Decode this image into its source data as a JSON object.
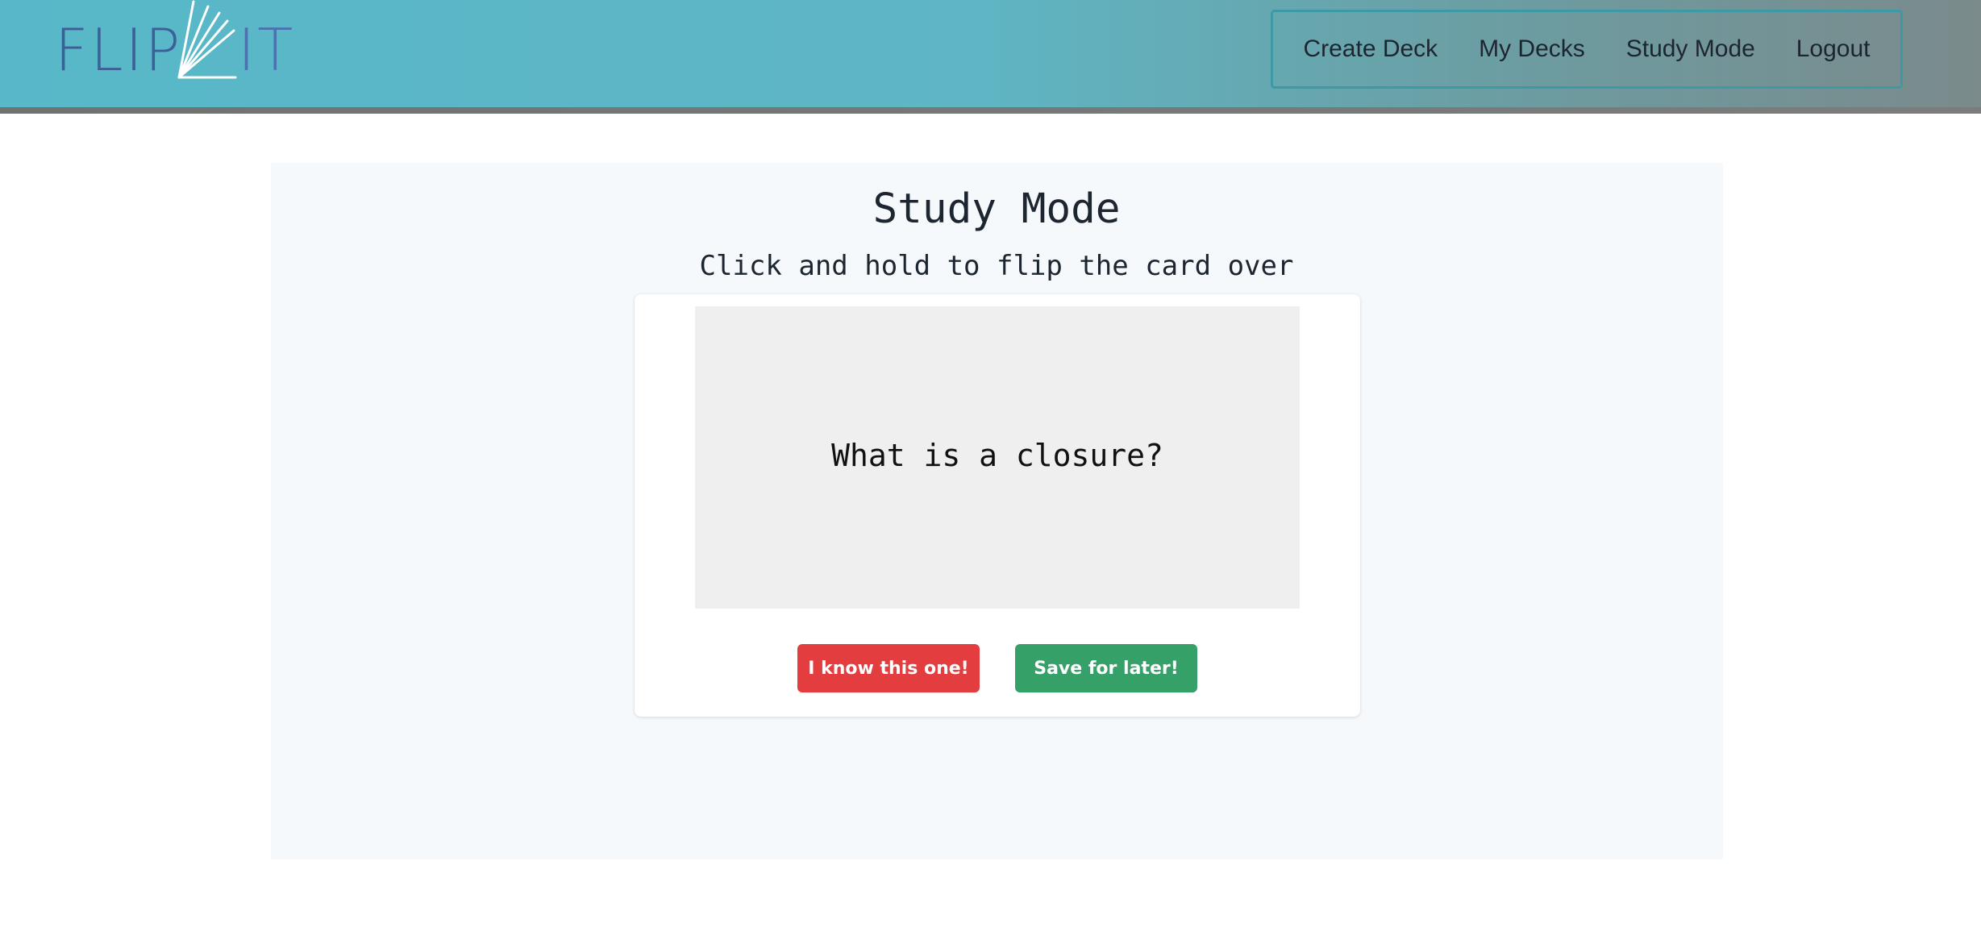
{
  "header": {
    "logo_left": "FLIP",
    "logo_right": "IT",
    "nav_items": [
      {
        "label": "Create Deck"
      },
      {
        "label": "My Decks"
      },
      {
        "label": "Study Mode"
      },
      {
        "label": "Logout"
      }
    ]
  },
  "main": {
    "title": "Study Mode",
    "subtitle": "Click and hold to flip the card over",
    "card": {
      "question": "What is a closure?"
    },
    "buttons": {
      "know_label": "I know this one!",
      "later_label": "Save for later!"
    }
  },
  "colors": {
    "header_teal": "#57b8c9",
    "logo_blue": "#3c5f97",
    "know_red": "#e33d3f",
    "later_green": "#35a067",
    "panel_bg": "#f5f9fc",
    "card_bg": "#efefef"
  },
  "icons": {
    "logo": "flip-it-fan-logo"
  }
}
